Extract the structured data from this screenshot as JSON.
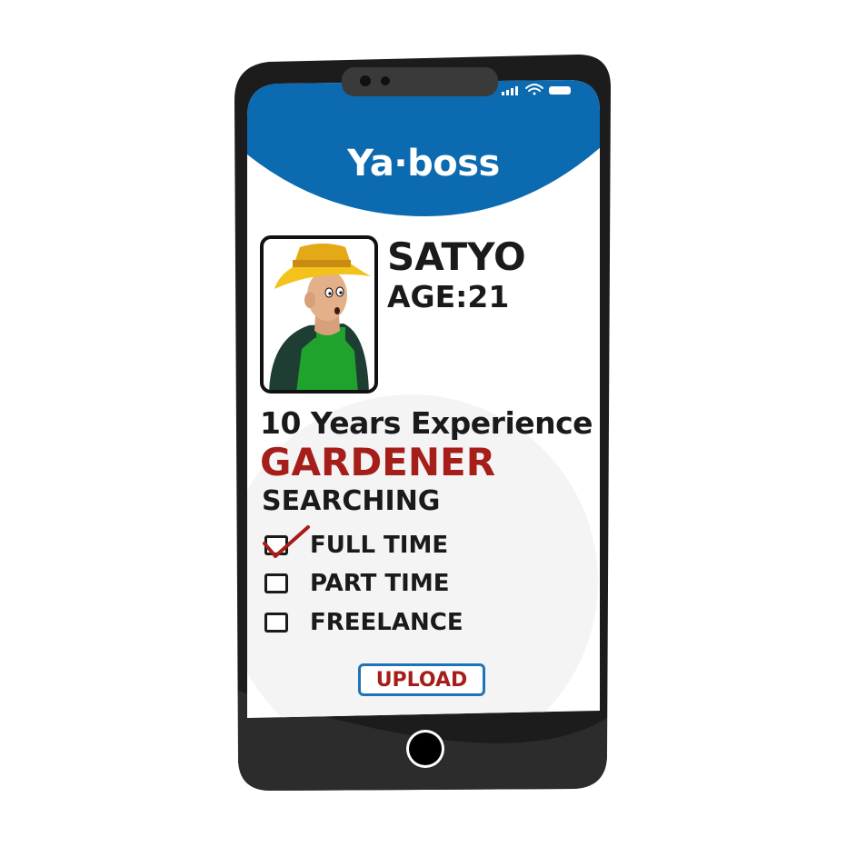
{
  "app": {
    "brand": "Ya·boss"
  },
  "profile": {
    "name": "SATYO",
    "age_label": "AGE:21",
    "experience": "10 Years Experience",
    "role": "GARDENER"
  },
  "searching": {
    "title": "SEARCHING",
    "options": [
      {
        "label": "FULL TIME",
        "checked": true
      },
      {
        "label": "PART TIME",
        "checked": false
      },
      {
        "label": "FREELANCE",
        "checked": false
      }
    ]
  },
  "actions": {
    "upload_label": "UPLOAD"
  },
  "colors": {
    "header_blue": "#0b6ab0",
    "accent_red": "#a51e1a",
    "phone_body": "#1c1c1c",
    "button_border": "#1e73b7"
  },
  "icons": [
    "signal-icon",
    "wifi-icon",
    "battery-icon",
    "gardener-avatar",
    "checkmark-icon",
    "home-button"
  ]
}
